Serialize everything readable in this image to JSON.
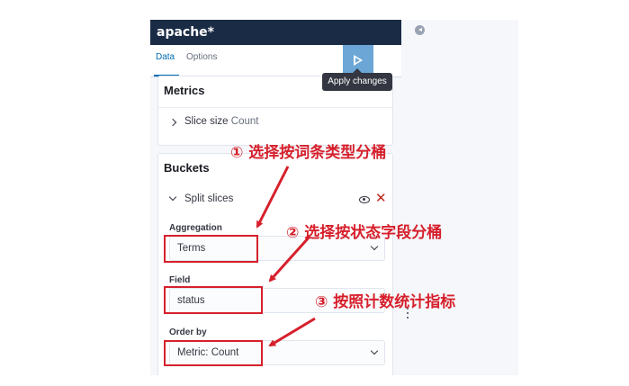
{
  "panel": {
    "index_pattern": "apache*",
    "tabs": [
      {
        "label": "Data",
        "active": true
      },
      {
        "label": "Options",
        "active": false
      }
    ],
    "apply_tooltip": "Apply changes",
    "close_glyph": "×"
  },
  "metrics": {
    "title": "Metrics",
    "item_label": "Slice size",
    "item_value": "Count"
  },
  "buckets": {
    "title": "Buckets",
    "item_label": "Split slices",
    "remove_glyph": "✕",
    "fields": [
      {
        "label": "Aggregation",
        "value": "Terms"
      },
      {
        "label": "Field",
        "value": "status"
      },
      {
        "label": "Order by",
        "value": "Metric: Count"
      }
    ]
  },
  "annotations": [
    "① 选择按词条类型分桶",
    "② 选择按状态字段分桶",
    "③ 按照计数统计指标"
  ],
  "colors": {
    "header_bg": "#1a2b45",
    "apply_button": "#6ba6d6",
    "active_tab": "#006bb4",
    "annotation_red": "#d6202c",
    "remove_red": "#bd271e"
  },
  "icons": [
    "play-icon",
    "close-icon",
    "chevron-right-icon",
    "chevron-down-icon",
    "eye-icon",
    "remove-icon",
    "collapse-icon"
  ]
}
